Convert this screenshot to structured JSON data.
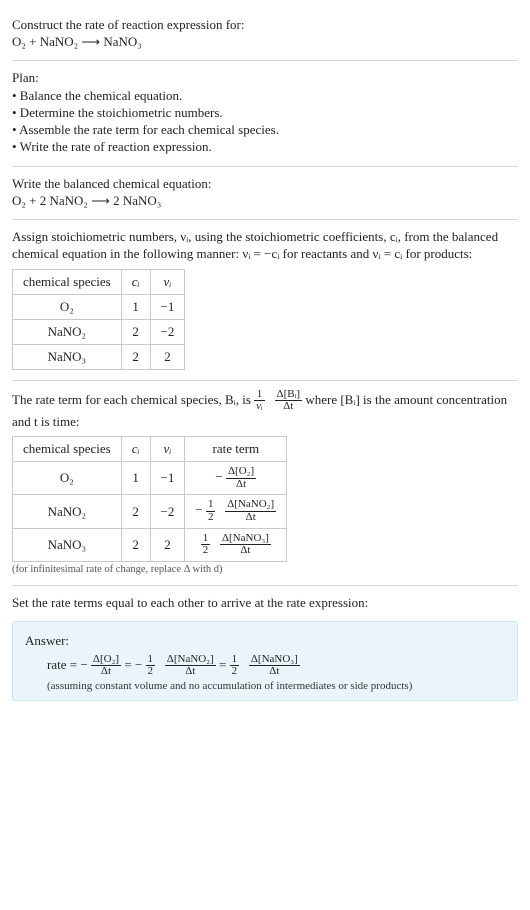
{
  "prompt": {
    "line1": "Construct the rate of reaction expression for:",
    "equation": "O₂ + NaNO₂  ⟶  NaNO₃"
  },
  "plan": {
    "title": "Plan:",
    "items": [
      "• Balance the chemical equation.",
      "• Determine the stoichiometric numbers.",
      "• Assemble the rate term for each chemical species.",
      "• Write the rate of reaction expression."
    ]
  },
  "balanced": {
    "title": "Write the balanced chemical equation:",
    "equation": "O₂ + 2 NaNO₂  ⟶  2 NaNO₃"
  },
  "assign": {
    "para": "Assign stoichiometric numbers, νᵢ, using the stoichiometric coefficients, cᵢ, from the balanced chemical equation in the following manner: νᵢ = −cᵢ for reactants and νᵢ = cᵢ for products:",
    "headers": [
      "chemical species",
      "cᵢ",
      "νᵢ"
    ],
    "rows": [
      {
        "species": "O₂",
        "ci": "1",
        "vi": "−1"
      },
      {
        "species": "NaNO₂",
        "ci": "2",
        "vi": "−2"
      },
      {
        "species": "NaNO₃",
        "ci": "2",
        "vi": "2"
      }
    ]
  },
  "rateterm": {
    "para_pre": "The rate term for each chemical species, Bᵢ, is ",
    "frac1_num": "1",
    "frac1_den": "νᵢ",
    "frac2_num": "Δ[Bᵢ]",
    "frac2_den": "Δt",
    "para_post": " where [Bᵢ] is the amount concentration and t is time:",
    "headers": [
      "chemical species",
      "cᵢ",
      "νᵢ",
      "rate term"
    ],
    "rows": [
      {
        "species": "O₂",
        "ci": "1",
        "vi": "−1",
        "rt_prefix": "−",
        "rt_coef_num": "",
        "rt_coef_den": "",
        "rt_num": "Δ[O₂]",
        "rt_den": "Δt"
      },
      {
        "species": "NaNO₂",
        "ci": "2",
        "vi": "−2",
        "rt_prefix": "−",
        "rt_coef_num": "1",
        "rt_coef_den": "2",
        "rt_num": "Δ[NaNO₂]",
        "rt_den": "Δt"
      },
      {
        "species": "NaNO₃",
        "ci": "2",
        "vi": "2",
        "rt_prefix": "",
        "rt_coef_num": "1",
        "rt_coef_den": "2",
        "rt_num": "Δ[NaNO₃]",
        "rt_den": "Δt"
      }
    ],
    "note": "(for infinitesimal rate of change, replace Δ with d)"
  },
  "setline": "Set the rate terms equal to each other to arrive at the rate expression:",
  "answer": {
    "title": "Answer:",
    "rate_label": "rate = ",
    "t1_prefix": "−",
    "t1_num": "Δ[O₂]",
    "t1_den": "Δt",
    "eq1": " = ",
    "t2_prefix": "−",
    "t2_cnum": "1",
    "t2_cden": "2",
    "t2_num": "Δ[NaNO₂]",
    "t2_den": "Δt",
    "eq2": " = ",
    "t3_cnum": "1",
    "t3_cden": "2",
    "t3_num": "Δ[NaNO₃]",
    "t3_den": "Δt",
    "assume": "(assuming constant volume and no accumulation of intermediates or side products)"
  }
}
